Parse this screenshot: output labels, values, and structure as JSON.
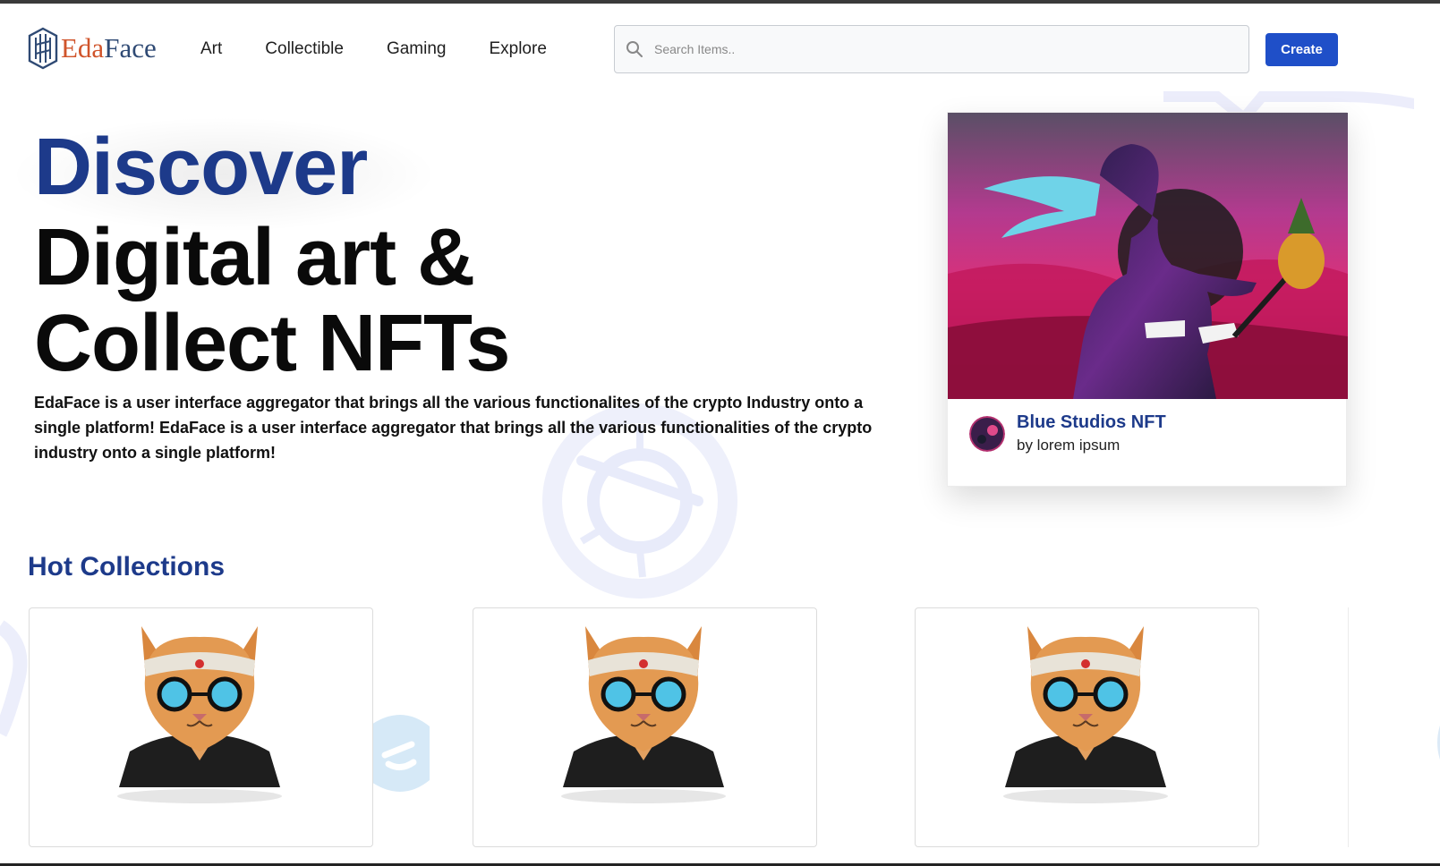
{
  "header": {
    "logo": {
      "prefix": "Eda",
      "suffix": "Face"
    },
    "nav": [
      {
        "label": "Art"
      },
      {
        "label": "Collectible"
      },
      {
        "label": "Gaming"
      },
      {
        "label": "Explore"
      }
    ],
    "search": {
      "placeholder": "Search Items.."
    },
    "create_label": "Create"
  },
  "hero": {
    "title_accent": "Discover",
    "title_line_1": "Digital art &",
    "title_line_2": "Collect NFTs",
    "description": "EdaFace is a user interface aggregator that brings all the various functionalites of the crypto Industry onto a single platform! EdaFace is a user interface aggregator that brings all the various functionalities of the crypto industry onto a single platform!"
  },
  "featured": {
    "title": "Blue Studios NFT",
    "subtitle": "by lorem ipsum"
  },
  "hot_collections": {
    "title": "Hot Collections",
    "items": [
      {},
      {},
      {}
    ]
  },
  "colors": {
    "brand_blue": "#1d3a8a",
    "button_blue": "#1f4fc8",
    "logo_orange": "#d0542b"
  }
}
